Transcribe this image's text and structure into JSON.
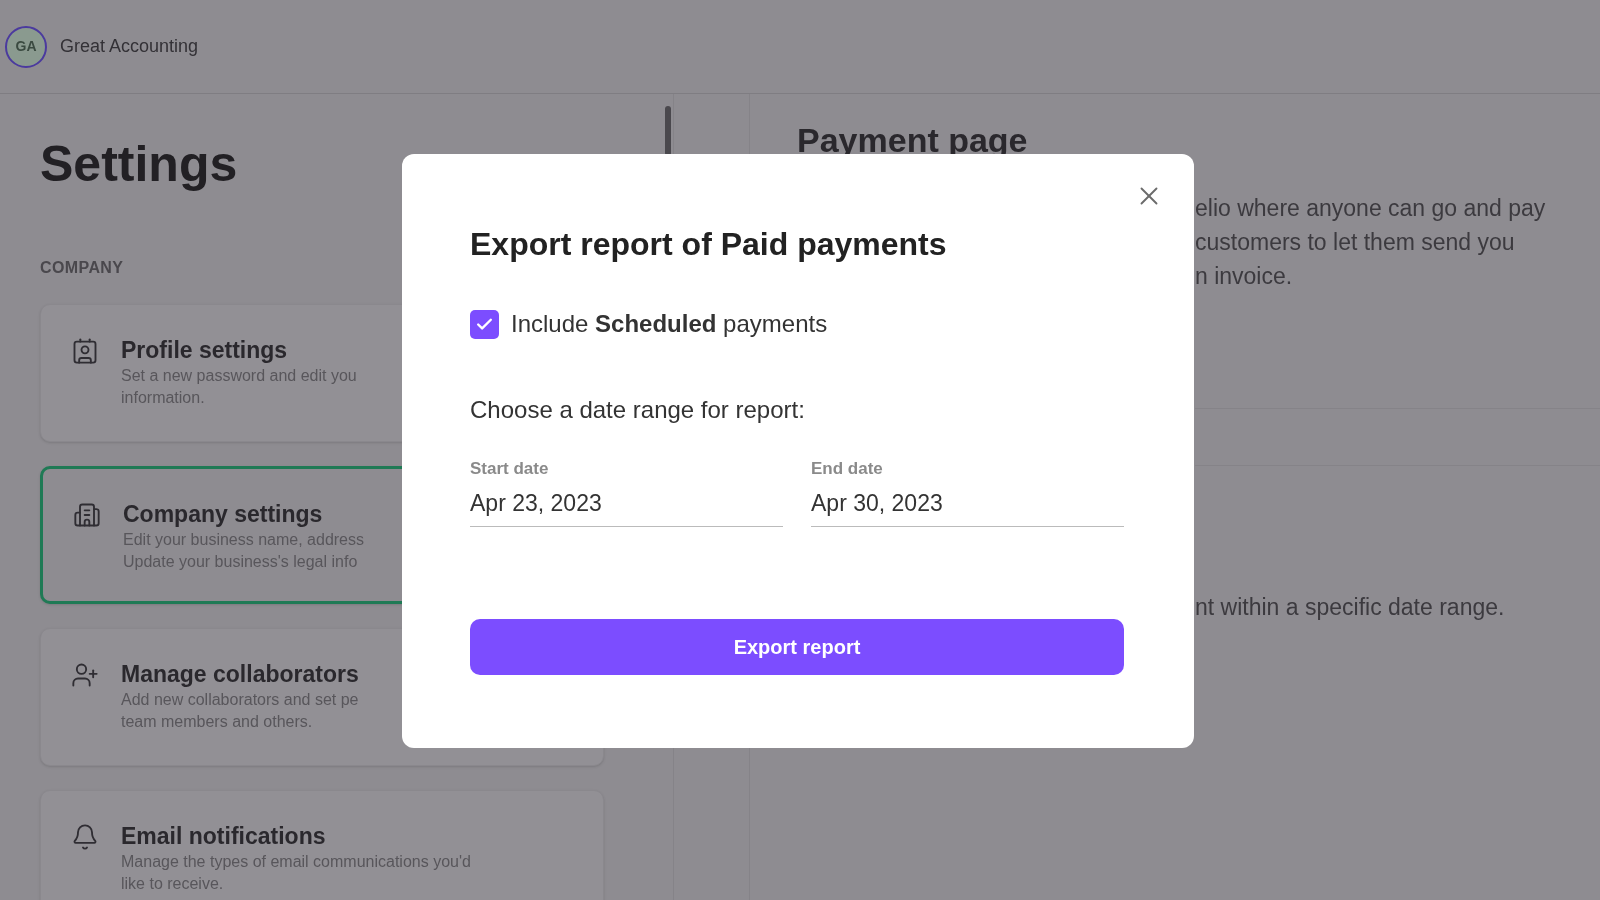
{
  "header": {
    "avatar_initials": "GA",
    "company_name": "Great Accounting"
  },
  "settings": {
    "title": "Settings",
    "section_label": "COMPANY",
    "cards": [
      {
        "kind": "profile",
        "title": "Profile settings",
        "description_lines": [
          "Set a new password and edit you",
          "information."
        ],
        "selected": false
      },
      {
        "kind": "company",
        "title": "Company settings",
        "description_lines": [
          "Edit your business name, address",
          "Update your business's legal info"
        ],
        "selected": true
      },
      {
        "kind": "collaborators",
        "title": "Manage collaborators",
        "description_lines": [
          "Add new collaborators and set pe",
          "team members and others."
        ],
        "selected": false
      },
      {
        "kind": "notifications",
        "title": "Email notifications",
        "description_lines": [
          "Manage the types of email communications you'd",
          "like to receive."
        ],
        "selected": false
      }
    ]
  },
  "payment_page": {
    "title": "Payment page",
    "text_lines": [
      "elio where anyone can go and pay",
      "customers to let them send you",
      "n invoice."
    ],
    "second_text": "nt within a specific date range."
  },
  "modal": {
    "title": "Export report of Paid payments",
    "include_option": {
      "checked": true,
      "label": "Include **Scheduled** payments"
    },
    "prompt": "Choose a date range for report:",
    "fields": [
      {
        "label": "Start date",
        "value": "Apr 23, 2023"
      },
      {
        "label": "End date",
        "value": "Apr 30, 2023"
      }
    ],
    "export_button": "Export report"
  }
}
